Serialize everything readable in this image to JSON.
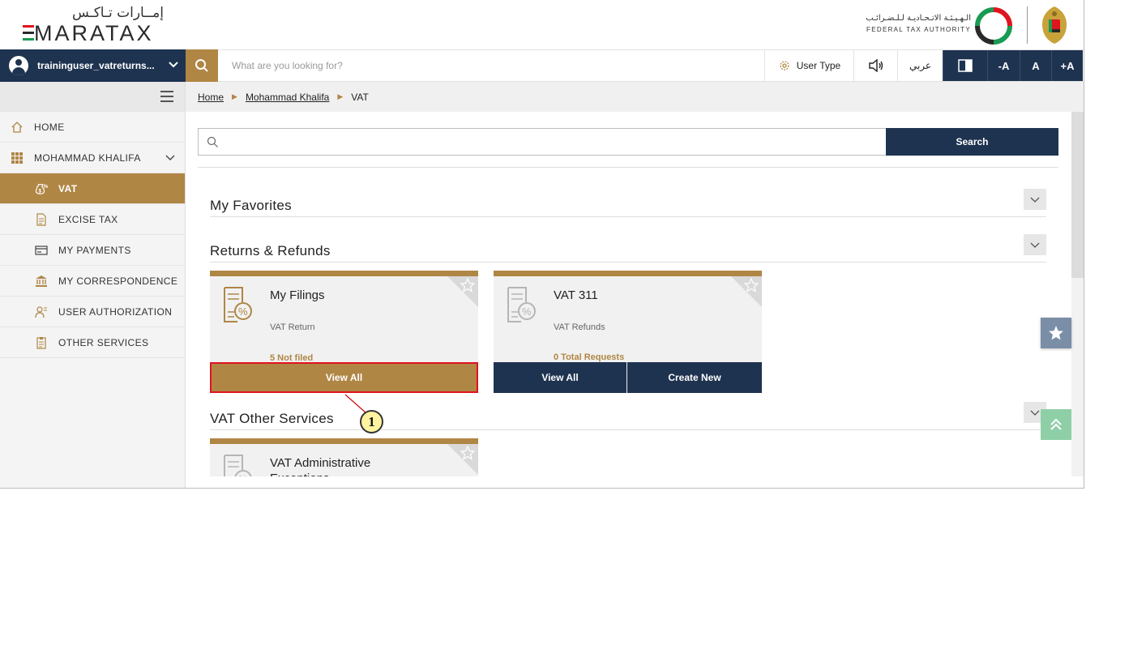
{
  "header": {
    "logo_ar": "إمــارات تـاكـس",
    "logo_en": "MARATAX",
    "authority_ar": "الـهـيـئـة الاتـحـاديـة لـلـضـرائـب",
    "authority_en": "FEDERAL TAX AUTHORITY"
  },
  "toolbar": {
    "username": "traininguser_vatreturns...",
    "search_placeholder": "What are you looking for?",
    "user_type_label": "User Type",
    "arabic_label": "عربي",
    "font_decrease": "-A",
    "font_normal": "A",
    "font_increase": "+A"
  },
  "sidebar": {
    "items": [
      {
        "label": "HOME",
        "icon": "home-icon"
      },
      {
        "label": "MOHAMMAD KHALIFA",
        "icon": "grid-icon"
      },
      {
        "label": "VAT",
        "icon": "money-bag-icon",
        "active": true
      },
      {
        "label": "EXCISE TAX",
        "icon": "document-icon"
      },
      {
        "label": "MY PAYMENTS",
        "icon": "card-icon"
      },
      {
        "label": "MY CORRESPONDENCE",
        "icon": "bank-icon"
      },
      {
        "label": "USER AUTHORIZATION",
        "icon": "user-key-icon"
      },
      {
        "label": "OTHER SERVICES",
        "icon": "clipboard-icon"
      }
    ]
  },
  "breadcrumb": {
    "home": "Home",
    "taxpayer": "Mohammad Khalifa",
    "current": "VAT"
  },
  "main": {
    "search_value": "",
    "search_button": "Search",
    "sections": {
      "favorites": "My Favorites",
      "returns": "Returns & Refunds",
      "other": "VAT Other Services"
    },
    "cards": [
      {
        "title": "My Filings",
        "subtitle": "VAT Return",
        "count": "5 Not filed",
        "view_all": "View All"
      },
      {
        "title": "VAT 311",
        "subtitle": "VAT Refunds",
        "count": "0 Total Requests",
        "view_all": "View All",
        "create_new": "Create New"
      },
      {
        "title": "VAT Administrative Exceptions"
      }
    ]
  },
  "annotation": {
    "step": "1"
  },
  "colors": {
    "gold": "#b08645",
    "navy": "#1e3350",
    "highlight": "#e0141e"
  }
}
